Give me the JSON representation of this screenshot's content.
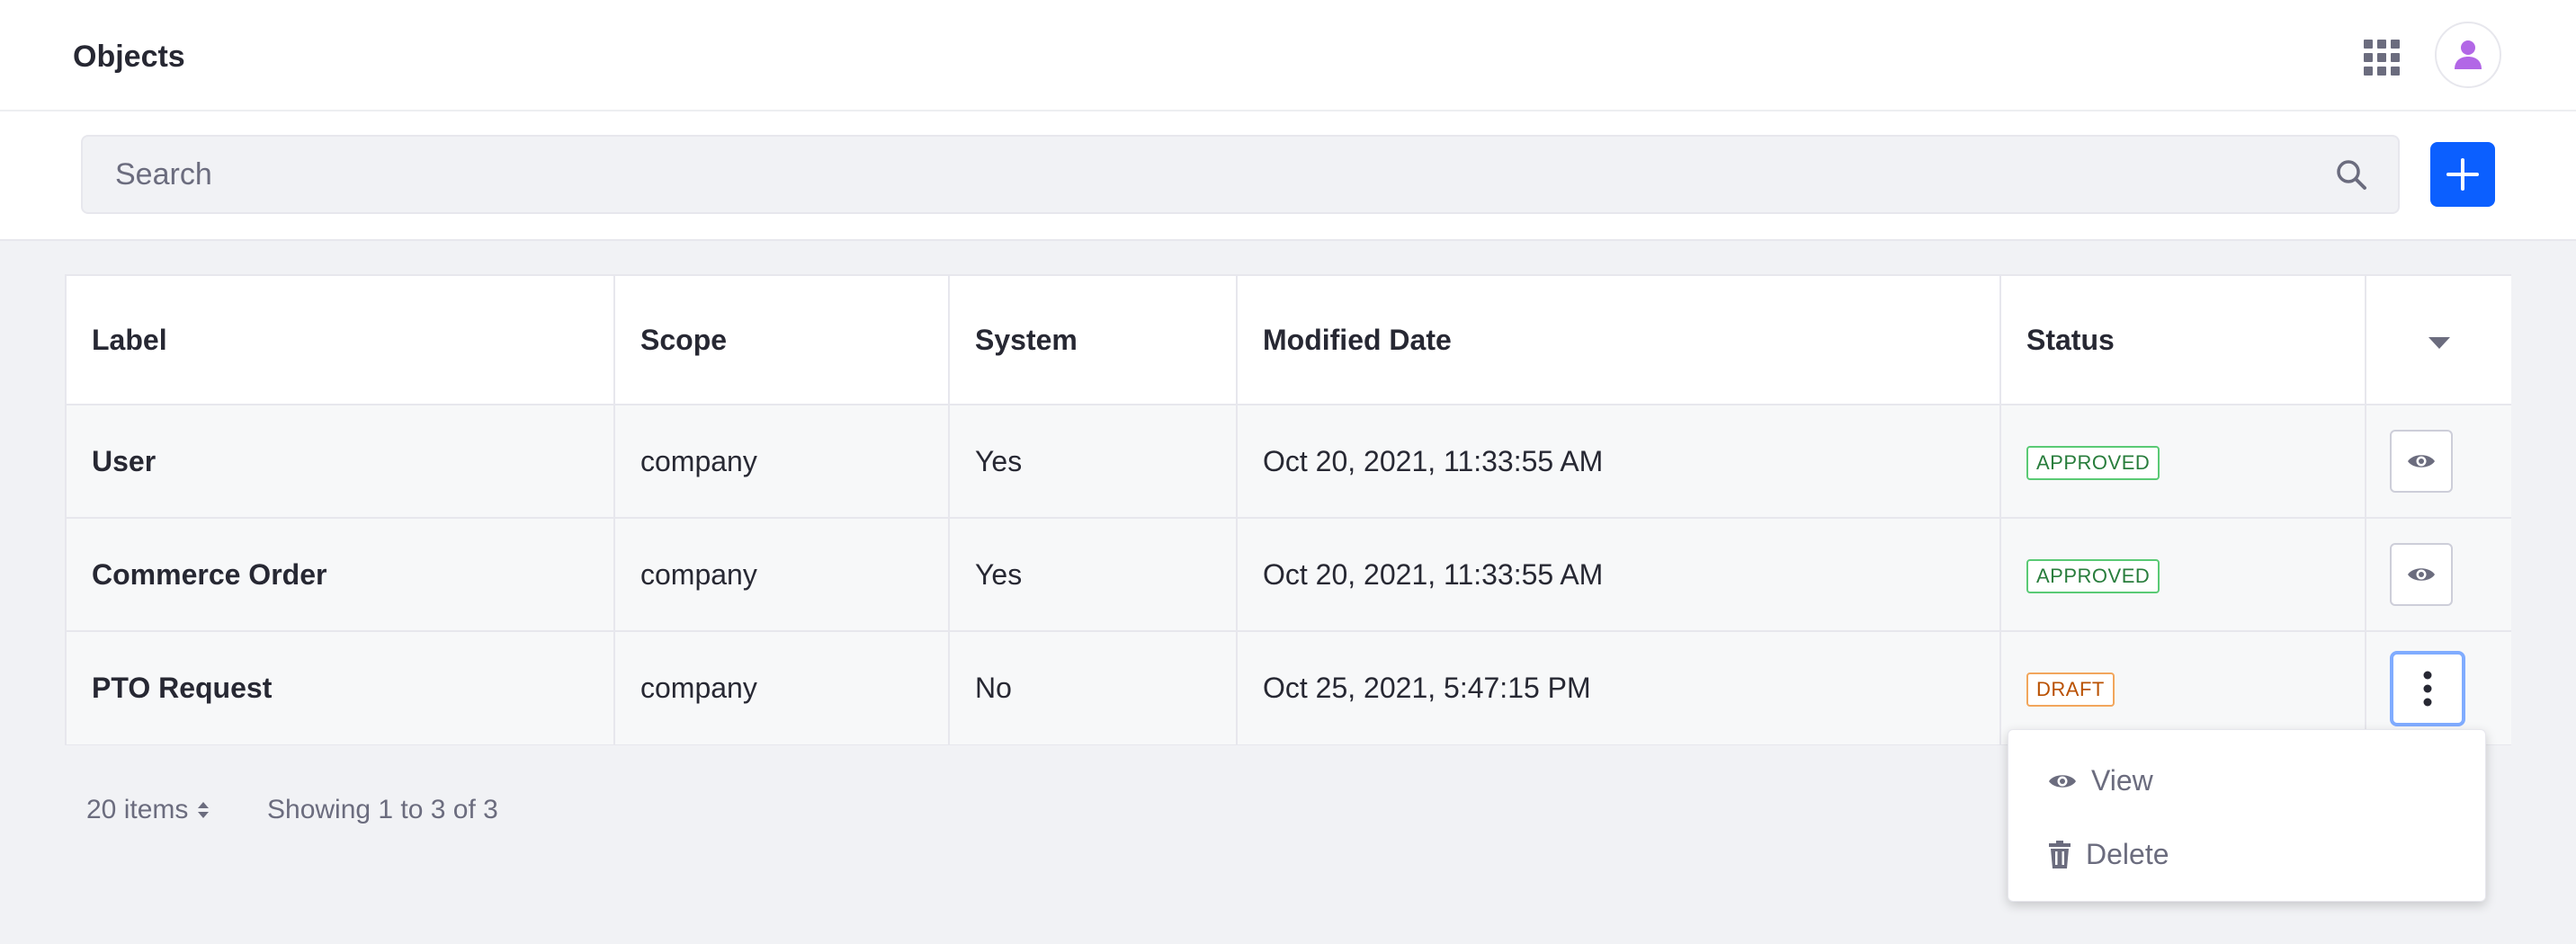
{
  "header": {
    "title": "Objects"
  },
  "search": {
    "placeholder": "Search"
  },
  "table": {
    "columns": [
      "Label",
      "Scope",
      "System",
      "Modified Date",
      "Status"
    ],
    "rows": [
      {
        "label": "User",
        "scope": "company",
        "system": "Yes",
        "modified": "Oct 20, 2021, 11:33:55 AM",
        "status": "APPROVED"
      },
      {
        "label": "Commerce Order",
        "scope": "company",
        "system": "Yes",
        "modified": "Oct 20, 2021, 11:33:55 AM",
        "status": "APPROVED"
      },
      {
        "label": "PTO Request",
        "scope": "company",
        "system": "No",
        "modified": "Oct 25, 2021, 5:47:15 PM",
        "status": "DRAFT"
      }
    ]
  },
  "pagination": {
    "items_per_page": "20 items",
    "status": "Showing 1 to 3 of 3"
  },
  "dropdown": {
    "items": [
      {
        "label": "View",
        "icon": "eye-icon"
      },
      {
        "label": "Delete",
        "icon": "trash-icon"
      }
    ]
  },
  "colors": {
    "primary": "#0b5fff",
    "approved": "#287d3c",
    "draft": "#b95000",
    "avatar": "#b267e6"
  }
}
